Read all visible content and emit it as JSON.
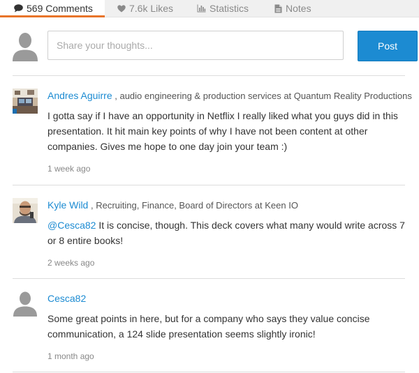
{
  "tabs": [
    {
      "label": "569 Comments",
      "icon": "speech-bubble-icon"
    },
    {
      "label": "7.6k Likes",
      "icon": "heart-icon"
    },
    {
      "label": "Statistics",
      "icon": "bar-chart-icon"
    },
    {
      "label": "Notes",
      "icon": "document-icon"
    }
  ],
  "composer": {
    "placeholder": "Share your thoughts...",
    "post_label": "Post"
  },
  "comments": [
    {
      "author": "Andres Aguirre",
      "headline": ", audio engineering & production services at Quantum Reality Productions",
      "mention": "",
      "text": "I gotta say if I have an opportunity in Netflix I really liked what you guys did in this presentation. It hit main key points of why I have not been content at other companies. Gives me hope to one day join your team :)",
      "time": "1 week ago",
      "avatar": "photo-avatar-studio"
    },
    {
      "author": "Kyle Wild",
      "headline": ", Recruiting, Finance, Board of Directors at Keen IO",
      "mention": "@Cesca82",
      "text": " It is concise, though. This deck covers what many would write across 7 or 8 entire books!",
      "time": "2 weeks ago",
      "avatar": "photo-avatar-person"
    },
    {
      "author": "Cesca82",
      "headline": "",
      "mention": "",
      "text": "Some great points in here, but for a company who says they value concise communication, a 124 slide presentation seems slightly ironic!",
      "time": "1 month ago",
      "avatar": "placeholder-avatar"
    }
  ],
  "colors": {
    "accent": "#1c8bd2",
    "tab_active_underline": "#e8742a",
    "avatar_grey": "#9a9a9a"
  }
}
